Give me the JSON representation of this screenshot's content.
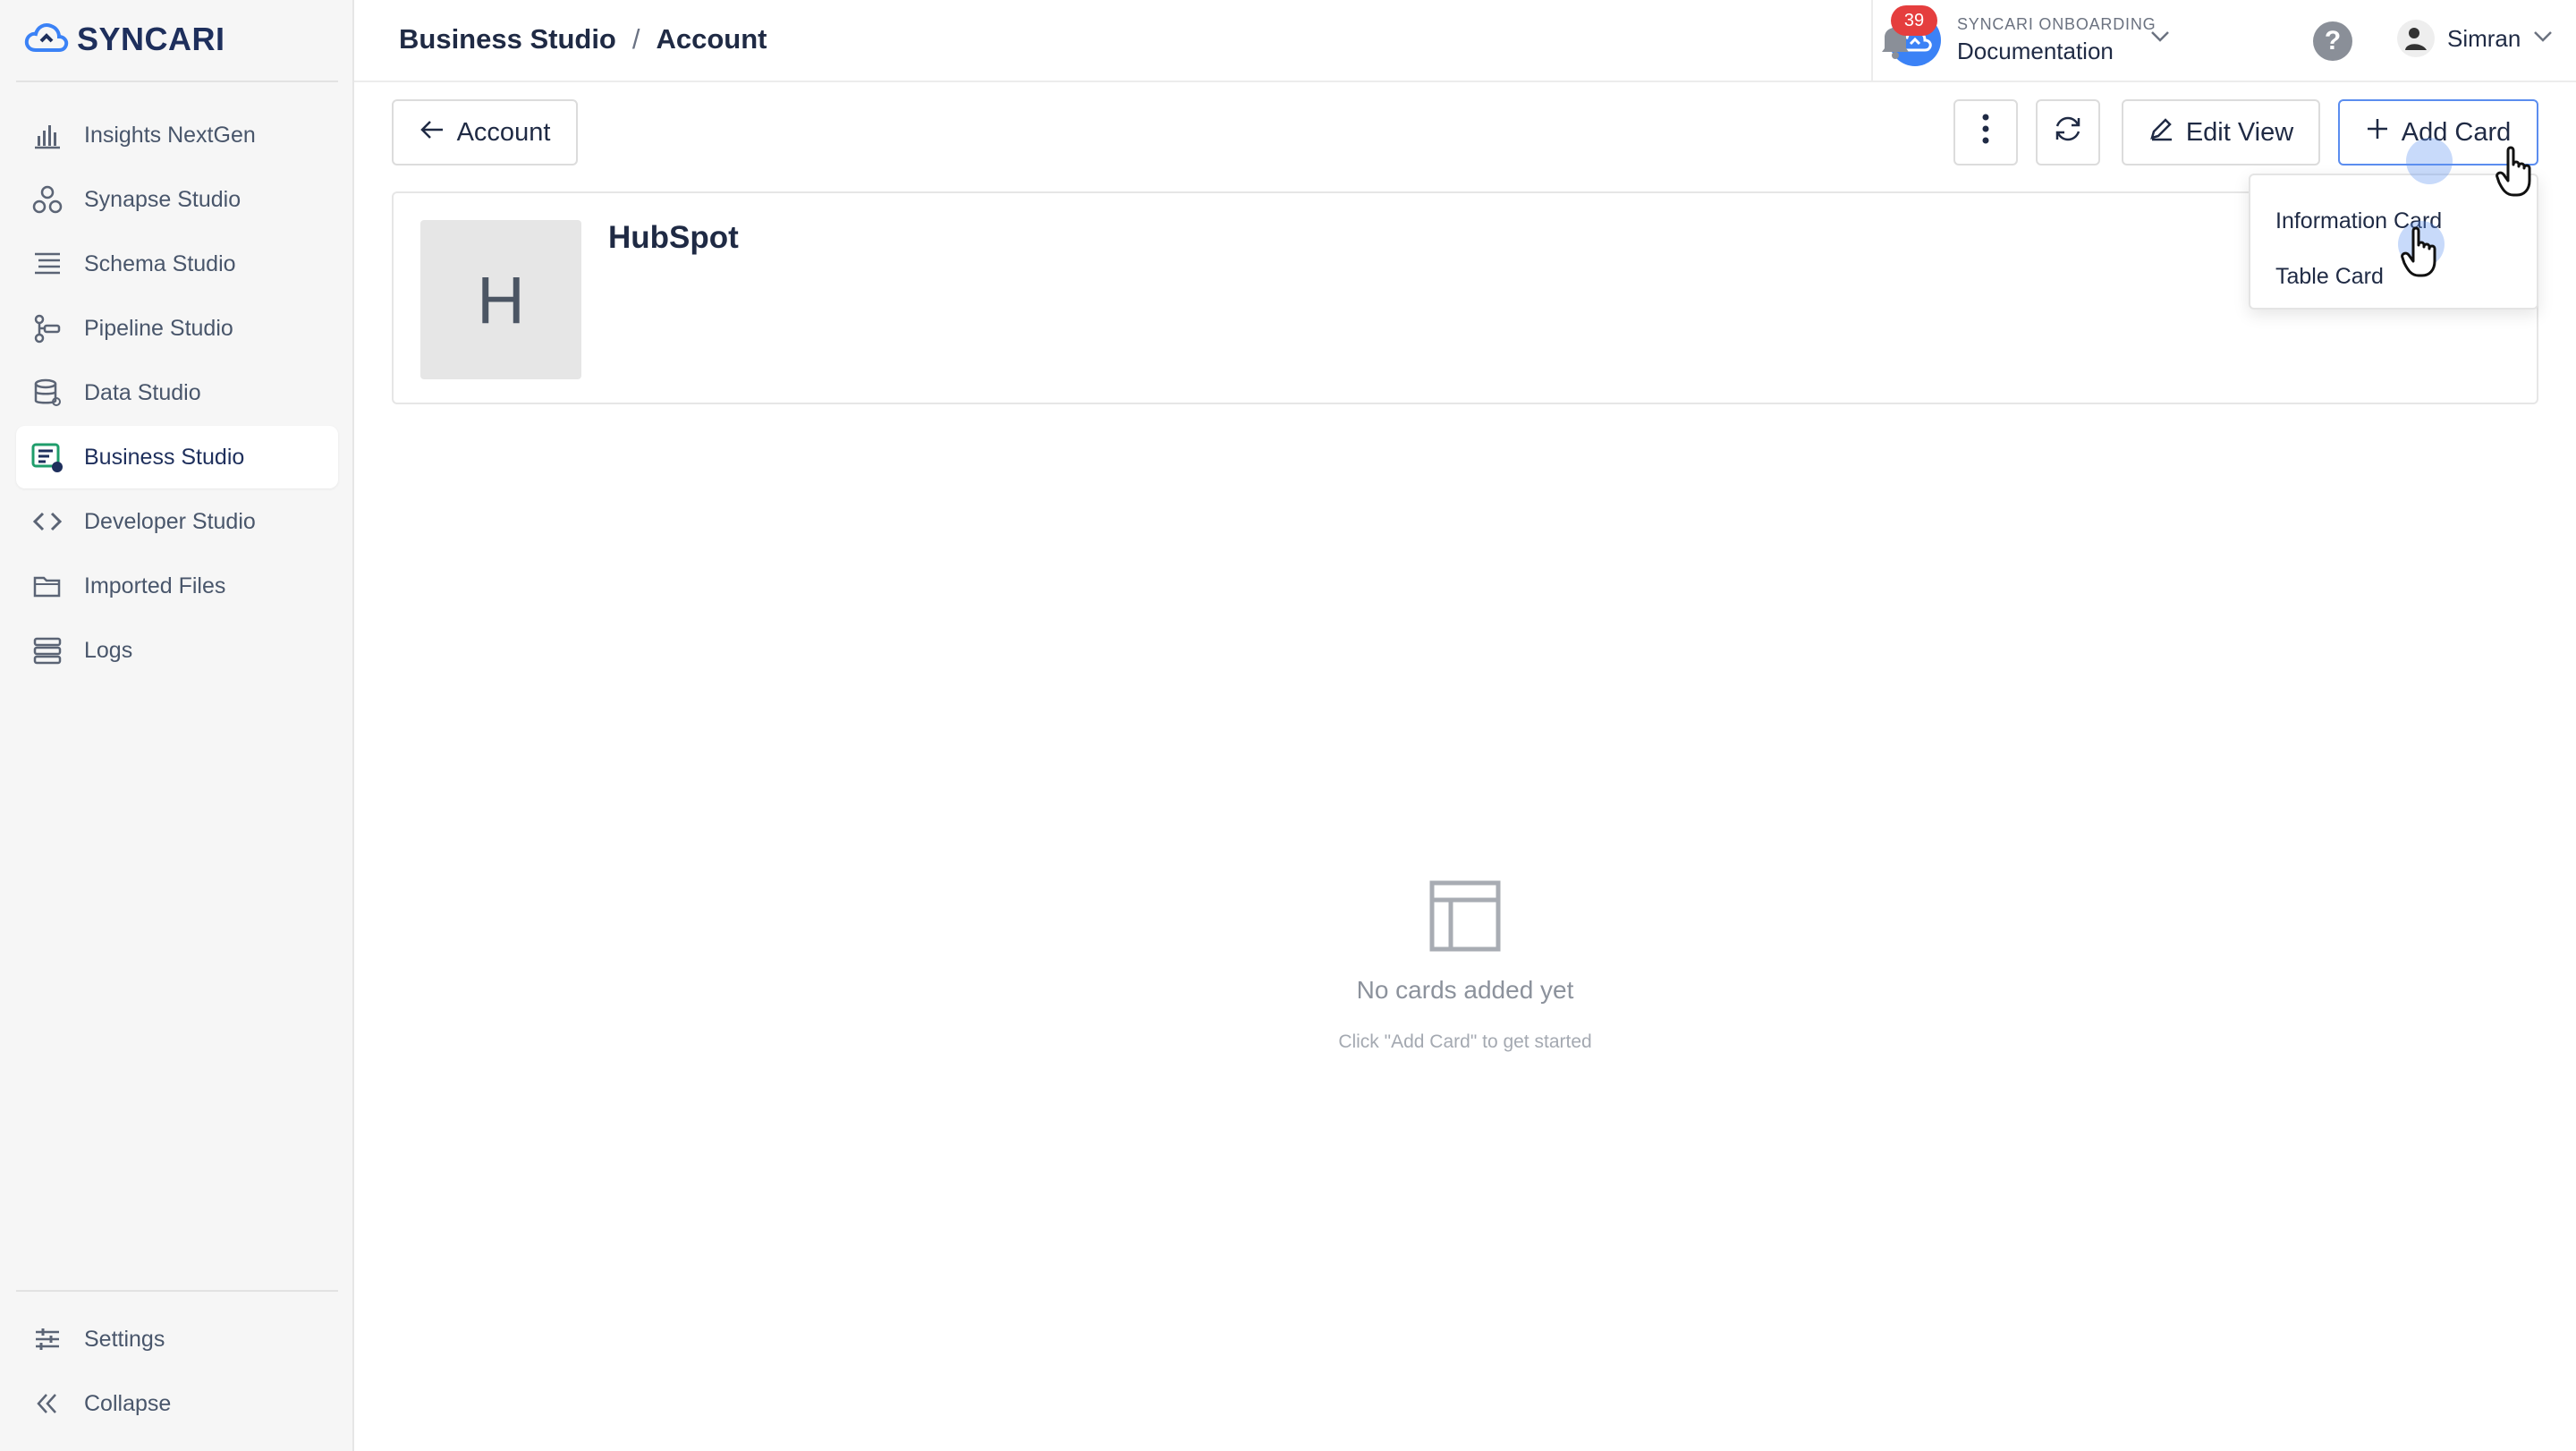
{
  "app": {
    "logo_text": "SYNCARI",
    "accent_color": "#3b82f6"
  },
  "sidebar": {
    "items": [
      {
        "label": "Insights NextGen",
        "icon": "bar-chart-icon"
      },
      {
        "label": "Synapse Studio",
        "icon": "nodes-icon"
      },
      {
        "label": "Schema Studio",
        "icon": "list-icon"
      },
      {
        "label": "Pipeline Studio",
        "icon": "pipeline-icon"
      },
      {
        "label": "Data Studio",
        "icon": "database-icon"
      },
      {
        "label": "Business Studio",
        "icon": "business-card-icon",
        "active": true
      },
      {
        "label": "Developer Studio",
        "icon": "code-icon"
      },
      {
        "label": "Imported Files",
        "icon": "folder-icon"
      },
      {
        "label": "Logs",
        "icon": "logs-icon"
      }
    ],
    "bottom": {
      "settings_label": "Settings",
      "collapse_label": "Collapse"
    }
  },
  "header": {
    "breadcrumb": [
      "Business Studio",
      "Account"
    ],
    "breadcrumb_separator": "/",
    "workspace": {
      "org": "SYNCARI ONBOARDING",
      "name": "Documentation"
    },
    "notifications_count": "39",
    "help_label": "?",
    "user_name": "Simran"
  },
  "toolbar": {
    "back_label": "Account",
    "edit_view_label": "Edit View",
    "add_card_label": "Add Card"
  },
  "record": {
    "avatar_letter": "H",
    "title": "HubSpot"
  },
  "add_card_menu": {
    "items": [
      "Information Card",
      "Table Card"
    ]
  },
  "empty_state": {
    "title": "No cards added yet",
    "subtitle": "Click \"Add Card\" to get started"
  }
}
